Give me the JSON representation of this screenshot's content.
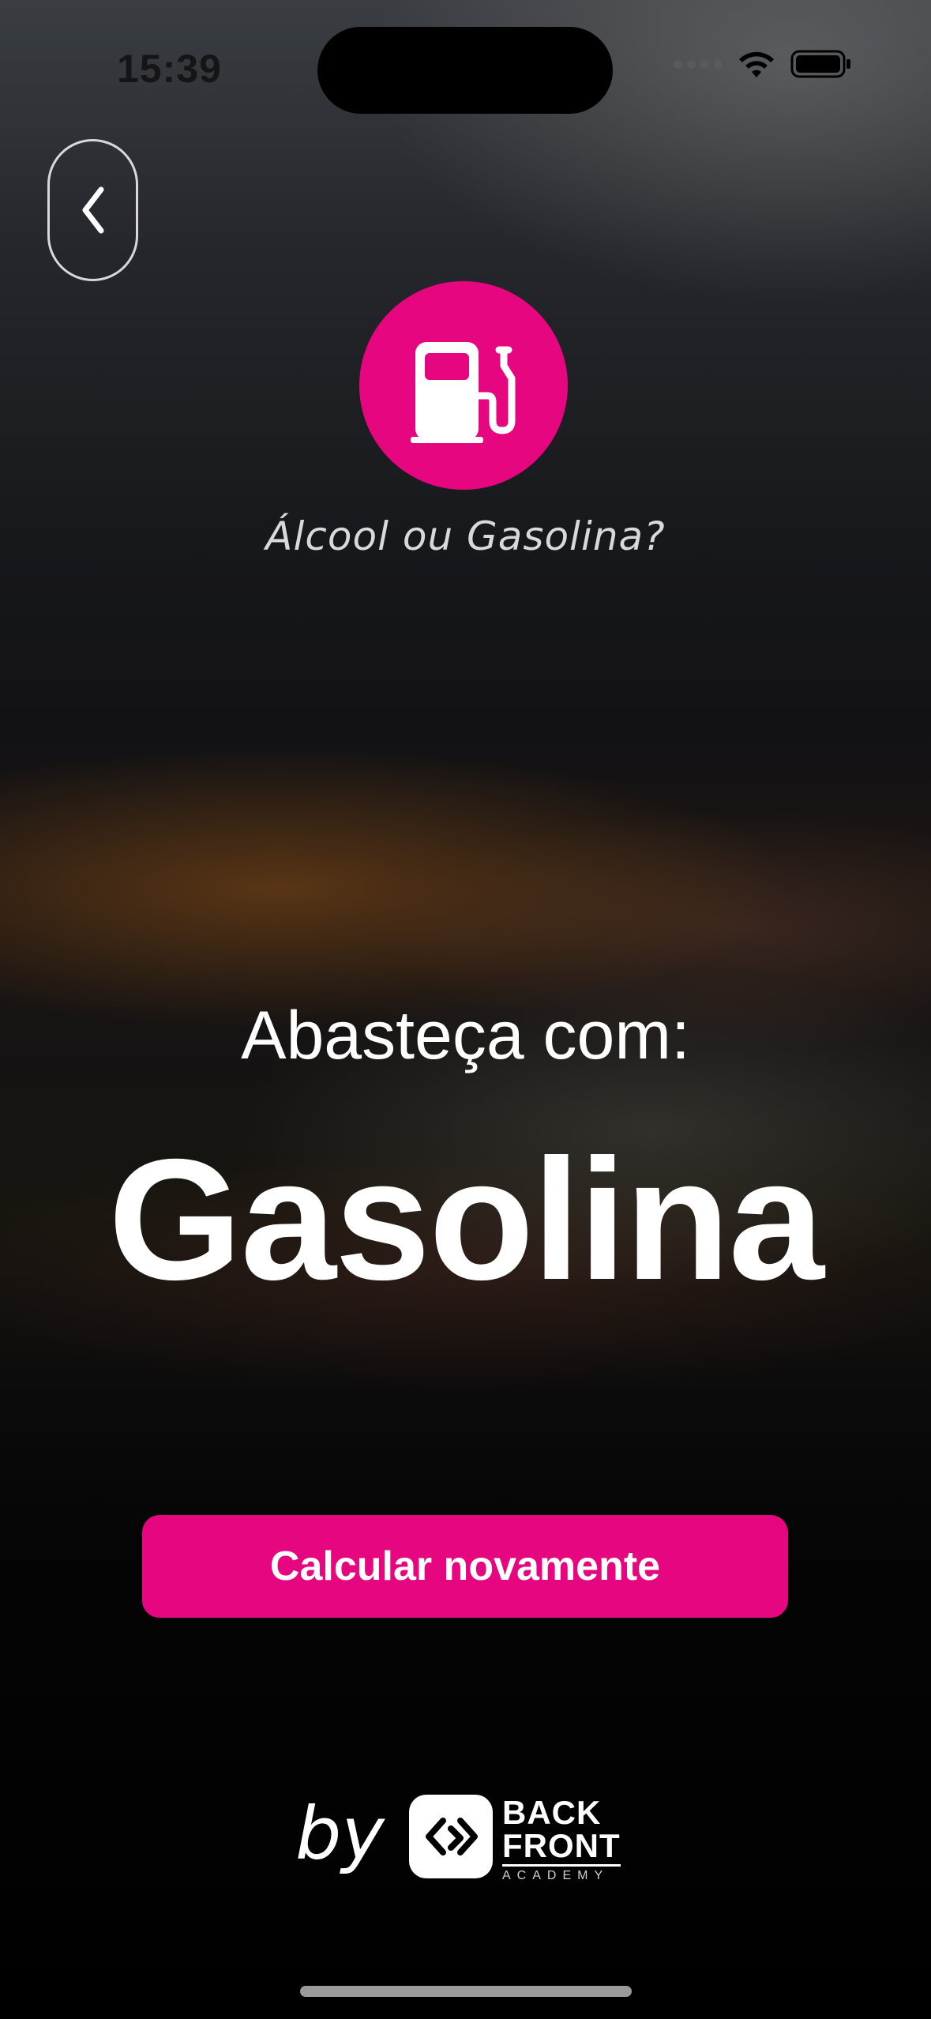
{
  "status_bar": {
    "time": "15:39"
  },
  "header": {
    "back_icon": "chevron-left-icon",
    "logo_icon": "fuel-pump-icon",
    "app_title": "Álcool ou Gasolina?"
  },
  "result": {
    "label": "Abasteça com:",
    "value": "Gasolina"
  },
  "actions": {
    "recalculate_label": "Calcular novamente"
  },
  "footer": {
    "by_label": "by",
    "brand_line1": "BACK",
    "brand_line2": "FRONT",
    "brand_line3": "ACADEMY"
  },
  "colors": {
    "accent": "#e6067f",
    "text": "#ffffff",
    "background": "#000000"
  }
}
